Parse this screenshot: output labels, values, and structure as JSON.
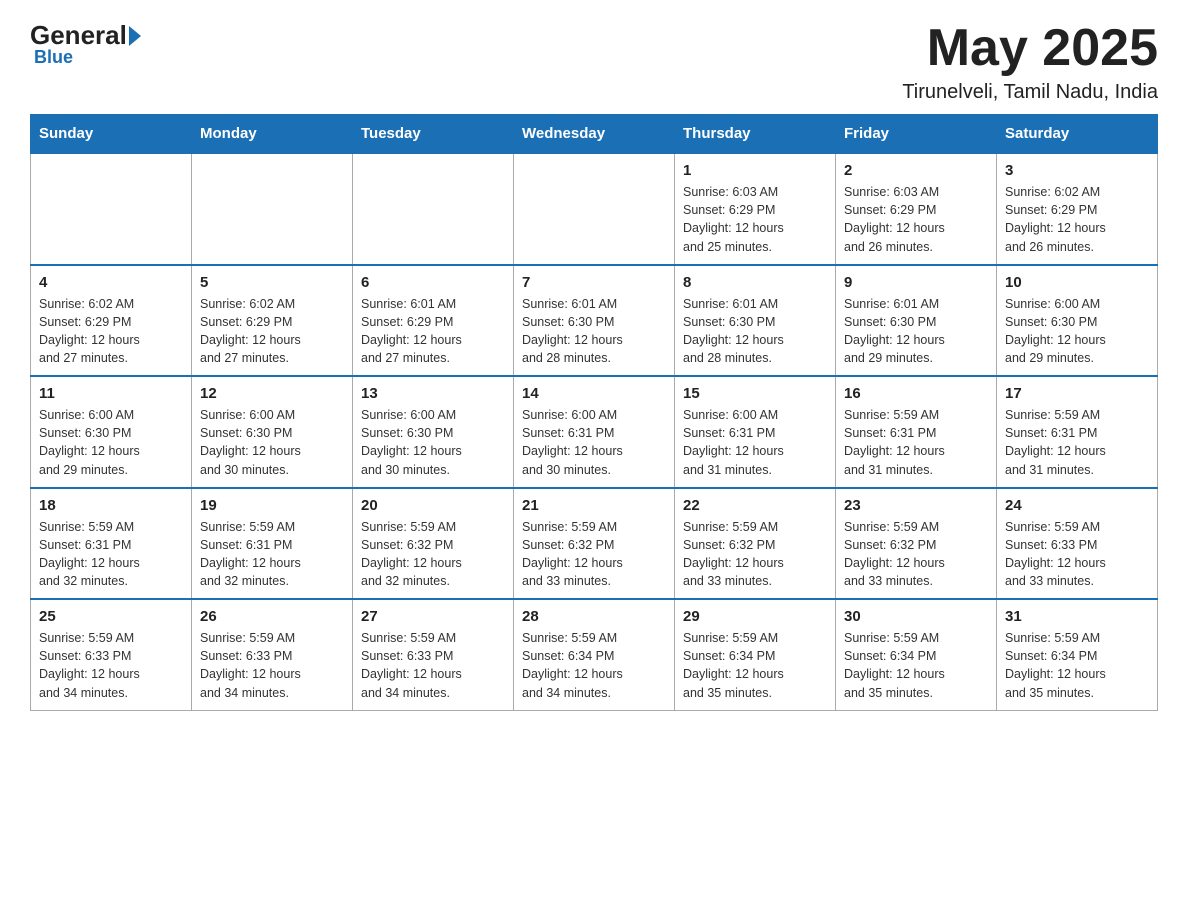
{
  "header": {
    "logo_general": "General",
    "logo_blue": "Blue",
    "month_title": "May 2025",
    "location": "Tirunelveli, Tamil Nadu, India"
  },
  "days_of_week": [
    "Sunday",
    "Monday",
    "Tuesday",
    "Wednesday",
    "Thursday",
    "Friday",
    "Saturday"
  ],
  "weeks": [
    [
      {
        "day": "",
        "info": ""
      },
      {
        "day": "",
        "info": ""
      },
      {
        "day": "",
        "info": ""
      },
      {
        "day": "",
        "info": ""
      },
      {
        "day": "1",
        "info": "Sunrise: 6:03 AM\nSunset: 6:29 PM\nDaylight: 12 hours\nand 25 minutes."
      },
      {
        "day": "2",
        "info": "Sunrise: 6:03 AM\nSunset: 6:29 PM\nDaylight: 12 hours\nand 26 minutes."
      },
      {
        "day": "3",
        "info": "Sunrise: 6:02 AM\nSunset: 6:29 PM\nDaylight: 12 hours\nand 26 minutes."
      }
    ],
    [
      {
        "day": "4",
        "info": "Sunrise: 6:02 AM\nSunset: 6:29 PM\nDaylight: 12 hours\nand 27 minutes."
      },
      {
        "day": "5",
        "info": "Sunrise: 6:02 AM\nSunset: 6:29 PM\nDaylight: 12 hours\nand 27 minutes."
      },
      {
        "day": "6",
        "info": "Sunrise: 6:01 AM\nSunset: 6:29 PM\nDaylight: 12 hours\nand 27 minutes."
      },
      {
        "day": "7",
        "info": "Sunrise: 6:01 AM\nSunset: 6:30 PM\nDaylight: 12 hours\nand 28 minutes."
      },
      {
        "day": "8",
        "info": "Sunrise: 6:01 AM\nSunset: 6:30 PM\nDaylight: 12 hours\nand 28 minutes."
      },
      {
        "day": "9",
        "info": "Sunrise: 6:01 AM\nSunset: 6:30 PM\nDaylight: 12 hours\nand 29 minutes."
      },
      {
        "day": "10",
        "info": "Sunrise: 6:00 AM\nSunset: 6:30 PM\nDaylight: 12 hours\nand 29 minutes."
      }
    ],
    [
      {
        "day": "11",
        "info": "Sunrise: 6:00 AM\nSunset: 6:30 PM\nDaylight: 12 hours\nand 29 minutes."
      },
      {
        "day": "12",
        "info": "Sunrise: 6:00 AM\nSunset: 6:30 PM\nDaylight: 12 hours\nand 30 minutes."
      },
      {
        "day": "13",
        "info": "Sunrise: 6:00 AM\nSunset: 6:30 PM\nDaylight: 12 hours\nand 30 minutes."
      },
      {
        "day": "14",
        "info": "Sunrise: 6:00 AM\nSunset: 6:31 PM\nDaylight: 12 hours\nand 30 minutes."
      },
      {
        "day": "15",
        "info": "Sunrise: 6:00 AM\nSunset: 6:31 PM\nDaylight: 12 hours\nand 31 minutes."
      },
      {
        "day": "16",
        "info": "Sunrise: 5:59 AM\nSunset: 6:31 PM\nDaylight: 12 hours\nand 31 minutes."
      },
      {
        "day": "17",
        "info": "Sunrise: 5:59 AM\nSunset: 6:31 PM\nDaylight: 12 hours\nand 31 minutes."
      }
    ],
    [
      {
        "day": "18",
        "info": "Sunrise: 5:59 AM\nSunset: 6:31 PM\nDaylight: 12 hours\nand 32 minutes."
      },
      {
        "day": "19",
        "info": "Sunrise: 5:59 AM\nSunset: 6:31 PM\nDaylight: 12 hours\nand 32 minutes."
      },
      {
        "day": "20",
        "info": "Sunrise: 5:59 AM\nSunset: 6:32 PM\nDaylight: 12 hours\nand 32 minutes."
      },
      {
        "day": "21",
        "info": "Sunrise: 5:59 AM\nSunset: 6:32 PM\nDaylight: 12 hours\nand 33 minutes."
      },
      {
        "day": "22",
        "info": "Sunrise: 5:59 AM\nSunset: 6:32 PM\nDaylight: 12 hours\nand 33 minutes."
      },
      {
        "day": "23",
        "info": "Sunrise: 5:59 AM\nSunset: 6:32 PM\nDaylight: 12 hours\nand 33 minutes."
      },
      {
        "day": "24",
        "info": "Sunrise: 5:59 AM\nSunset: 6:33 PM\nDaylight: 12 hours\nand 33 minutes."
      }
    ],
    [
      {
        "day": "25",
        "info": "Sunrise: 5:59 AM\nSunset: 6:33 PM\nDaylight: 12 hours\nand 34 minutes."
      },
      {
        "day": "26",
        "info": "Sunrise: 5:59 AM\nSunset: 6:33 PM\nDaylight: 12 hours\nand 34 minutes."
      },
      {
        "day": "27",
        "info": "Sunrise: 5:59 AM\nSunset: 6:33 PM\nDaylight: 12 hours\nand 34 minutes."
      },
      {
        "day": "28",
        "info": "Sunrise: 5:59 AM\nSunset: 6:34 PM\nDaylight: 12 hours\nand 34 minutes."
      },
      {
        "day": "29",
        "info": "Sunrise: 5:59 AM\nSunset: 6:34 PM\nDaylight: 12 hours\nand 35 minutes."
      },
      {
        "day": "30",
        "info": "Sunrise: 5:59 AM\nSunset: 6:34 PM\nDaylight: 12 hours\nand 35 minutes."
      },
      {
        "day": "31",
        "info": "Sunrise: 5:59 AM\nSunset: 6:34 PM\nDaylight: 12 hours\nand 35 minutes."
      }
    ]
  ]
}
